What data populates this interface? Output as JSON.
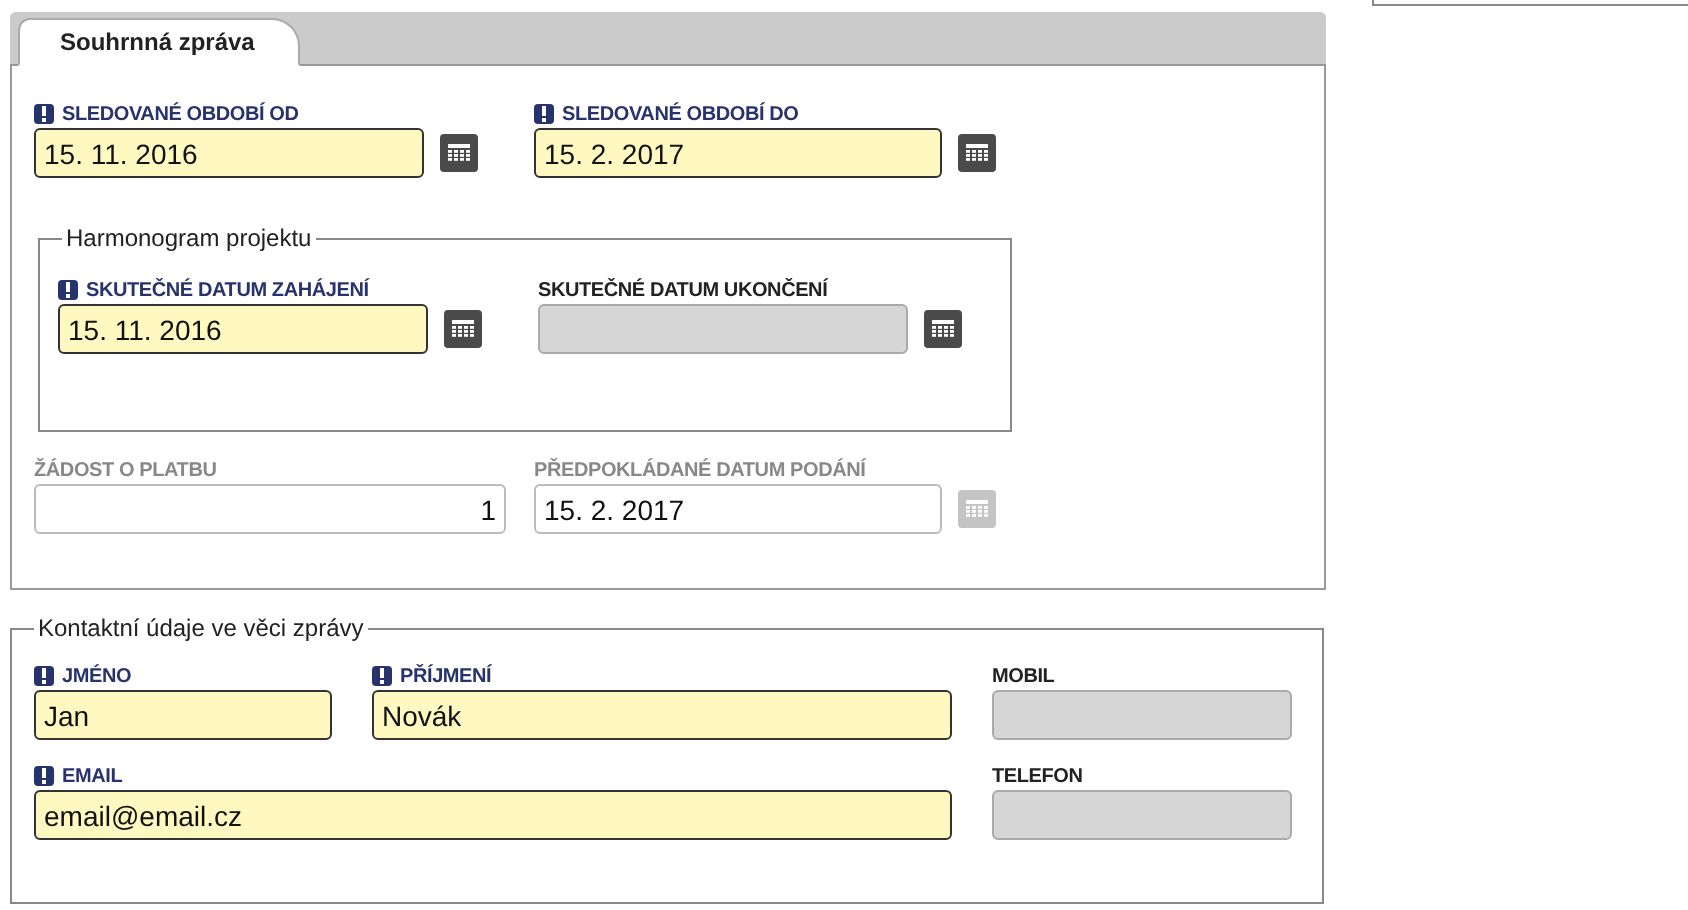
{
  "tabs": [
    {
      "label": "Souhrnná zpráva",
      "selected": true
    }
  ],
  "period": [
    {
      "label": "SLEDOVANÉ OBDOBÍ OD",
      "value": "15. 11. 2016",
      "kind": "date",
      "required": true,
      "locked": false,
      "readonly": false
    },
    {
      "label": "SLEDOVANÉ OBDOBÍ DO",
      "value": "15. 2. 2017",
      "kind": "date",
      "required": true,
      "locked": false,
      "readonly": false
    }
  ],
  "schedule": {
    "legend": "Harmonogram projektu",
    "fields": [
      {
        "label": "SKUTEČNÉ DATUM ZAHÁJENÍ",
        "value": "15. 11. 2016",
        "kind": "date",
        "required": true,
        "locked": false,
        "readonly": false
      },
      {
        "label": "SKUTEČNÉ DATUM UKONČENÍ",
        "kind": "date",
        "required": false,
        "locked": true,
        "readonly": false
      }
    ]
  },
  "payment": [
    {
      "label": "ŽÁDOST O PLATBU",
      "value": "1",
      "kind": "number",
      "required": false,
      "locked": false,
      "readonly": true
    },
    {
      "label": "PŘEDPOKLÁDANÉ DATUM PODÁNÍ",
      "value": "15. 2. 2017",
      "kind": "date",
      "required": false,
      "locked": false,
      "readonly": true
    }
  ],
  "contact": {
    "legend": "Kontaktní údaje ve věci zprávy",
    "fields": [
      {
        "label": "JMÉNO",
        "value": "Jan",
        "kind": "text",
        "required": true,
        "locked": false,
        "readonly": false
      },
      {
        "label": "PŘÍJMENÍ",
        "value": "Novák",
        "kind": "text",
        "required": true,
        "locked": false,
        "readonly": false
      },
      {
        "label": "MOBIL",
        "kind": "text",
        "required": false,
        "locked": true,
        "readonly": false
      },
      {
        "label": "EMAIL",
        "value": "email@email.cz",
        "kind": "text",
        "required": true,
        "locked": false,
        "readonly": false
      },
      {
        "label": "TELEFON",
        "kind": "text",
        "required": false,
        "locked": true,
        "readonly": false
      }
    ]
  }
}
